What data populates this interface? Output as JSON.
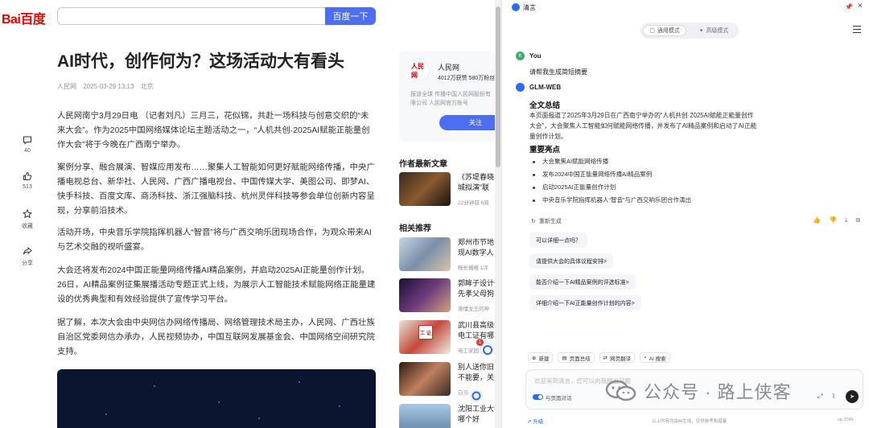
{
  "baidu": {
    "logo": "Bai百度",
    "search_button": "百度一下",
    "article": {
      "title": "AI时代，创作何为？这场活动大有看头",
      "source": "人民网",
      "time": "2025-03-29 13:13",
      "location": "北京",
      "paragraphs": [
        "人民网南宁3月29日电 （记者刘凡）三月三，花似锦，共赴一场科技与创意交织的“未来大会”。作为2025中国网络媒体论坛主题活动之一，“人机共创·2025AI赋能正能量创作大会”将于今晚在广西南宁举办。",
        "案例分享、融合展演、智媒应用发布……聚集人工智能如何更好赋能网络传播，中央广播电视总台、新华社、人民网、广西广播电视台、中国传媒大学、美图公司、即梦AI、快手科技、百度文库、商汤科技、浙江强脑科技、杭州灵伴科技等参会单位创新内容呈现，分享前沿技术。",
        "活动开场，中央音乐学院指挥机器人“智音”将与广西交响乐团现场合作，为观众带来AI与艺术交融的视听盛宴。",
        "大会还将发布2024中国正能量网络传播AI精品案例，并启动2025AI正能量创作计划。26日，AI精品案例征集展播活动专题正式上线，为展示人工智能技术赋能网络正能量建设的优秀典型和有效经验提供了宣传学习平台。",
        "据了解，本次大会由中央网信办网络传播局、网络管理技术局主办，人民网、广西壮族自治区党委网信办承办，人民视频协办，中国互联网发展基金会、中国网络空间研究院支持。"
      ]
    },
    "actions": [
      {
        "label": "40"
      },
      {
        "label": "513"
      },
      {
        "label": "收藏"
      },
      {
        "label": "分享"
      }
    ],
    "author": {
      "name": "人民网",
      "stats": "4012万获赞 580万粉丝",
      "desc": "报道全球 传播中国人民网股份有限公司 人民网官方账号",
      "follow": "关注",
      "avatar": "人民网"
    },
    "latest_heading": "作者最新文章",
    "latest": [
      {
        "title": "《苏堤春晓",
        "title2": "城拟演”联",
        "meta": "22分钟前",
        "meta2": "6阅"
      }
    ],
    "related_heading": "相关推荐",
    "related": [
      {
        "title": "郑州市节地",
        "title2": "现AI数字人",
        "meta": "畅长播报",
        "meta2": "1评"
      },
      {
        "title": "郭眸子设计作",
        "title2": "先孝父母狗",
        "meta": "萧懂龙王的神"
      },
      {
        "title": "武川县高级中",
        "title2": "电工证有哪",
        "meta": "电工家园",
        "thumb_label": "工 证"
      },
      {
        "title": "别人送你旧",
        "title2": "不能要，关",
        "meta": "白马"
      },
      {
        "title": "沈阳工业大学",
        "title2": "哪个好"
      }
    ],
    "notification_badge": "1"
  },
  "panel": {
    "title": "清言",
    "modes": {
      "general": "通用模式",
      "advanced": "高级模式"
    },
    "user": {
      "avatar": "K",
      "name": "You",
      "message": "请帮我生成简短摘要"
    },
    "bot": {
      "name": "GLM-WEB",
      "summary_title": "全文总结",
      "summary": "本页面报道了2025年3月29日在广西南宁举办的“人机共创·2025AI赋能正能量创作大会”，大会聚焦人工智能如何赋能网络传播，并发布了AI精品案例和启动了AI正能量创作计划。",
      "highlights_title": "重要亮点",
      "highlights": [
        "大会聚焦AI赋能网络传播",
        "发布2024中国正能量网络传播AI精品案例",
        "启动2025AI正能量创作计划",
        "中央音乐学院指挥机器人“智音”与广西交响乐团合作演出"
      ],
      "regenerate": "重新生成"
    },
    "suggestions": [
      "可以详细一点吗？",
      "请提供大会的具体议程安排>",
      "能否介绍一下AI精品案例的评选标准>",
      "详细介绍一下AI正能量创作计划的内容>"
    ],
    "tools": [
      "新建",
      "页面总结",
      "网页翻译",
      "AI 搜索"
    ],
    "input": {
      "placeholder": "欢迎来到清言，您可以向我提出问题",
      "toggle_label": "与页面对话"
    },
    "footer": {
      "left": "⇗ 升级",
      "mid": "以上内容均由AI生成，仅供参考和借鉴",
      "right": "sp 3745"
    }
  },
  "watermark": "公众号 · 路上侠客",
  "colors": {
    "baidu_blue": "#4e6ef2",
    "baidu_red": "#e10602",
    "glm_blue": "#2a6df4"
  }
}
